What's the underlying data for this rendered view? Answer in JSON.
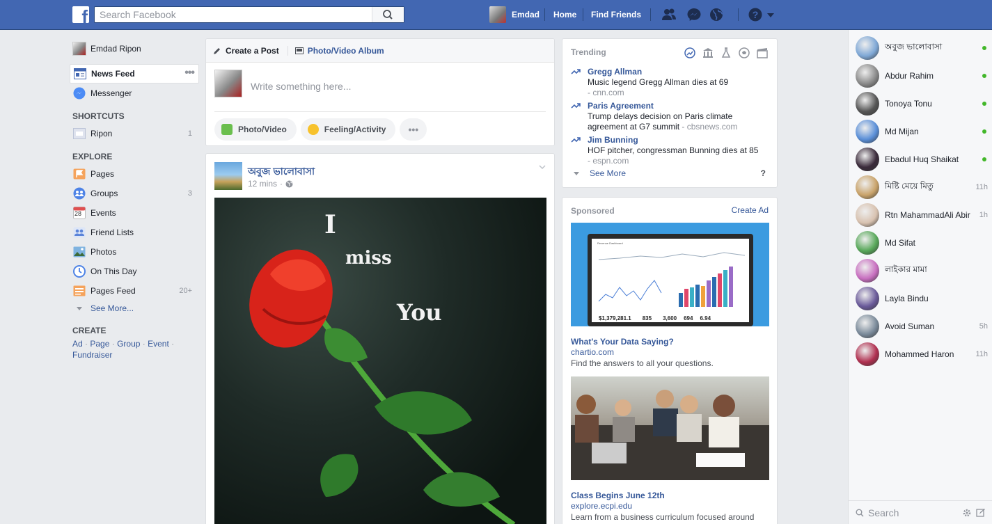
{
  "topbar": {
    "logo": "f",
    "search_placeholder": "Search Facebook",
    "user_name": "Emdad",
    "home": "Home",
    "find_friends": "Find Friends"
  },
  "left_nav": {
    "user": "Emdad Ripon",
    "news_feed": "News Feed",
    "news_feed_more": "•••",
    "messenger": "Messenger",
    "shortcuts_head": "SHORTCUTS",
    "shortcuts": [
      {
        "label": "Ripon",
        "count": "1"
      }
    ],
    "explore_head": "EXPLORE",
    "explore": [
      {
        "label": "Pages",
        "count": ""
      },
      {
        "label": "Groups",
        "count": "3"
      },
      {
        "label": "Events",
        "count": ""
      },
      {
        "label": "Friend Lists",
        "count": ""
      },
      {
        "label": "Photos",
        "count": ""
      },
      {
        "label": "On This Day",
        "count": ""
      },
      {
        "label": "Pages Feed",
        "count": "20+"
      }
    ],
    "events_icon_text": "28",
    "see_more": "See More...",
    "create_head": "CREATE",
    "create_links": [
      "Ad",
      "Page",
      "Group",
      "Event",
      "Fundraiser"
    ]
  },
  "composer": {
    "tab_create": "Create a Post",
    "tab_album": "Photo/Video Album",
    "placeholder": "Write something here...",
    "btn_photo": "Photo/Video",
    "btn_feeling": "Feeling/Activity",
    "btn_more": "•••"
  },
  "post": {
    "author": "অবুজ ভালোবাসা",
    "time": "12 mins",
    "separator": "·",
    "image_text": [
      "I",
      "miss",
      "You"
    ]
  },
  "trending": {
    "title": "Trending",
    "items": [
      {
        "title": "Gregg Allman",
        "desc": "Music legend Gregg Allman dies at 69",
        "source": "- cnn.com"
      },
      {
        "title": "Paris Agreement",
        "desc": "Trump delays decision on Paris climate agreement at G7 summit",
        "source": "- cbsnews.com"
      },
      {
        "title": "Jim Bunning",
        "desc": "HOF pitcher, congressman Bunning dies at 85",
        "source": "- espn.com"
      }
    ],
    "see_more": "See More",
    "help": "?"
  },
  "sponsored": {
    "title": "Sponsored",
    "create_ad": "Create Ad",
    "dashboard_title": "Revenue Dashboard",
    "dashboard_stats": [
      "$1,379,281.1",
      "835",
      "3,600",
      "694",
      "6.94"
    ],
    "ads": [
      {
        "title": "What's Your Data Saying?",
        "domain": "chartio.com",
        "desc": "Find the answers to all your questions."
      },
      {
        "title": "Class Begins June 12th",
        "domain": "explore.ecpi.edu",
        "desc": "Learn from a business curriculum focused around"
      }
    ]
  },
  "chat": {
    "contacts": [
      {
        "name": "অবুজ ভালোবাসা",
        "status": "online",
        "color": "#7fa8d6"
      },
      {
        "name": "Abdur Rahim",
        "status": "online",
        "color": "#8a8a8a"
      },
      {
        "name": "Tonoya Tonu",
        "status": "online",
        "color": "#555555"
      },
      {
        "name": "Md Mijan",
        "status": "online",
        "color": "#5a8fd8"
      },
      {
        "name": "Ebadul Huq Shaikat",
        "status": "online",
        "color": "#3a2a3a"
      },
      {
        "name": "মিষ্টি মেয়ে মিতু",
        "status": "11h",
        "color": "#c9a36a"
      },
      {
        "name": "Rtn MahammadAli Abir",
        "status": "1h",
        "color": "#d8c2b0"
      },
      {
        "name": "Md Sifat",
        "status": "",
        "color": "#58a85a"
      },
      {
        "name": "লাইকার মামা",
        "status": "",
        "color": "#c86fc0"
      },
      {
        "name": "Layla Bindu",
        "status": "",
        "color": "#6a5a9a"
      },
      {
        "name": "Avoid Suman",
        "status": "5h",
        "color": "#7a8a9a"
      },
      {
        "name": "Mohammed Haron",
        "status": "11h",
        "color": "#b03050"
      }
    ],
    "search_placeholder": "Search"
  },
  "colors": {
    "brand": "#4267b2",
    "link": "#365899",
    "online": "#42b72a",
    "background": "#e9ebee"
  }
}
